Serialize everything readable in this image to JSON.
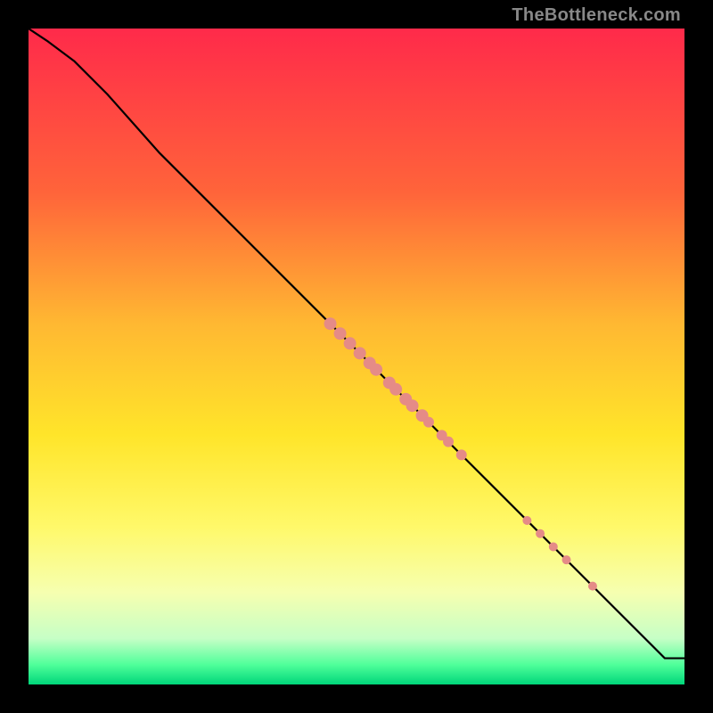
{
  "watermark": "TheBottleneck.com",
  "chart_data": {
    "type": "line",
    "title": "",
    "xlabel": "",
    "ylabel": "",
    "xlim": [
      0,
      100
    ],
    "ylim": [
      0,
      100
    ],
    "gradient_stops": [
      {
        "offset": 0,
        "color": "#ff2a4a"
      },
      {
        "offset": 25,
        "color": "#ff643a"
      },
      {
        "offset": 45,
        "color": "#ffb832"
      },
      {
        "offset": 62,
        "color": "#ffe52a"
      },
      {
        "offset": 76,
        "color": "#fff96a"
      },
      {
        "offset": 86,
        "color": "#f6ffb0"
      },
      {
        "offset": 93,
        "color": "#c6ffc6"
      },
      {
        "offset": 97,
        "color": "#4fff9a"
      },
      {
        "offset": 100,
        "color": "#00d67a"
      }
    ],
    "curve": [
      {
        "x": 0,
        "y": 100
      },
      {
        "x": 3,
        "y": 98
      },
      {
        "x": 7,
        "y": 95
      },
      {
        "x": 12,
        "y": 90
      },
      {
        "x": 20,
        "y": 81
      },
      {
        "x": 30,
        "y": 71
      },
      {
        "x": 40,
        "y": 61
      },
      {
        "x": 50,
        "y": 51
      },
      {
        "x": 60,
        "y": 41
      },
      {
        "x": 70,
        "y": 31
      },
      {
        "x": 80,
        "y": 21
      },
      {
        "x": 90,
        "y": 11
      },
      {
        "x": 95,
        "y": 6
      },
      {
        "x": 97,
        "y": 4
      },
      {
        "x": 100,
        "y": 4
      }
    ],
    "markers": {
      "color": "#e58b87",
      "points": [
        {
          "x": 46.0,
          "y": 55.0,
          "r": 7
        },
        {
          "x": 47.5,
          "y": 53.5,
          "r": 7
        },
        {
          "x": 49.0,
          "y": 52.0,
          "r": 7
        },
        {
          "x": 50.5,
          "y": 50.5,
          "r": 7
        },
        {
          "x": 52.0,
          "y": 49.0,
          "r": 7
        },
        {
          "x": 53.0,
          "y": 48.0,
          "r": 7
        },
        {
          "x": 55.0,
          "y": 46.0,
          "r": 7
        },
        {
          "x": 56.0,
          "y": 45.0,
          "r": 7
        },
        {
          "x": 57.5,
          "y": 43.5,
          "r": 7
        },
        {
          "x": 58.5,
          "y": 42.5,
          "r": 7
        },
        {
          "x": 60.0,
          "y": 41.0,
          "r": 7
        },
        {
          "x": 61.0,
          "y": 40.0,
          "r": 6
        },
        {
          "x": 63.0,
          "y": 38.0,
          "r": 6
        },
        {
          "x": 64.0,
          "y": 37.0,
          "r": 6
        },
        {
          "x": 66.0,
          "y": 35.0,
          "r": 6
        },
        {
          "x": 76.0,
          "y": 25.0,
          "r": 5
        },
        {
          "x": 78.0,
          "y": 23.0,
          "r": 5
        },
        {
          "x": 80.0,
          "y": 21.0,
          "r": 5
        },
        {
          "x": 82.0,
          "y": 19.0,
          "r": 5
        },
        {
          "x": 86.0,
          "y": 15.0,
          "r": 5
        }
      ]
    }
  }
}
